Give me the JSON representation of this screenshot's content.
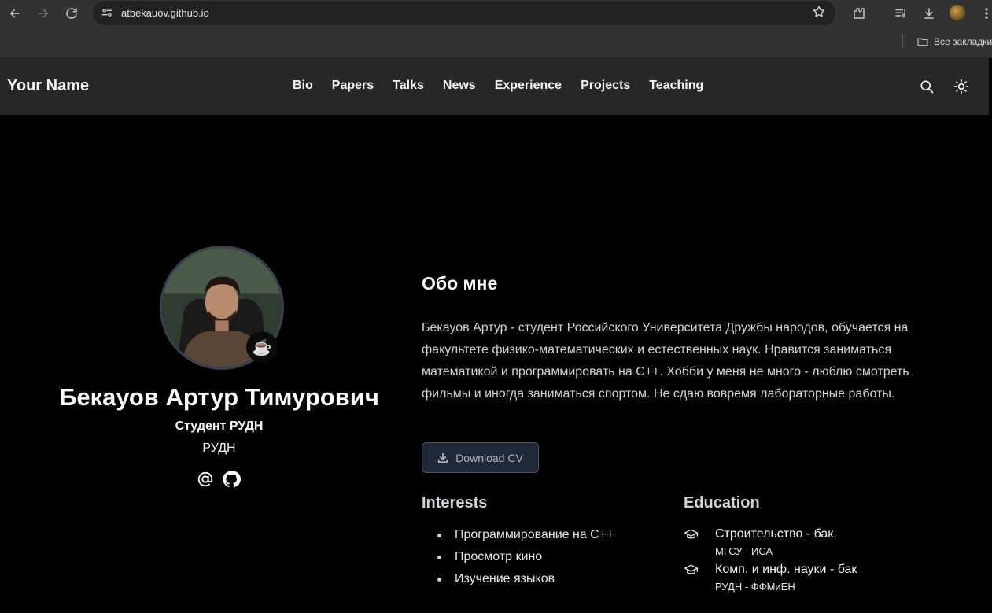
{
  "browser": {
    "url": "atbekauov.github.io",
    "bookmarks_label": "Все закладки"
  },
  "navbar": {
    "brand": "Your Name",
    "links": [
      "Bio",
      "Papers",
      "Talks",
      "News",
      "Experience",
      "Projects",
      "Teaching"
    ]
  },
  "profile": {
    "status_emoji": "☕",
    "name": "Бекауов Артур Тимурович",
    "role": "Студент РУДН",
    "organization": "РУДН"
  },
  "about": {
    "title": "Обо мне",
    "text": "Бекауов Артур - студент Российского Университета Дружбы народов, обучается на факультете физико-математических и естественных наук. Нравится заниматься математикой и программировать на C++. Хобби у меня не много - люблю смотреть фильмы и иногда заниматься спортом. Не сдаю вовремя лабораторные работы.",
    "cv_button": "Download CV"
  },
  "interests": {
    "title": "Interests",
    "items": [
      "Программирование на C++",
      "Просмотр кино",
      "Изучение языков"
    ]
  },
  "education": {
    "title": "Education",
    "items": [
      {
        "degree": "Строительство - бак.",
        "institution": "МГСУ - ИСА"
      },
      {
        "degree": "Комп. и инф. науки - бак",
        "institution": "РУДН - ФФМиЕН"
      }
    ]
  }
}
